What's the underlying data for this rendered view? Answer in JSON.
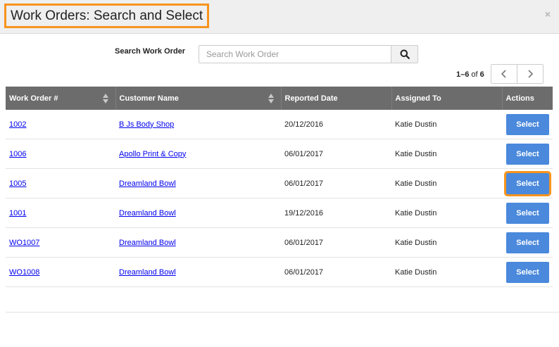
{
  "dialog": {
    "title": "Work Orders: Search and Select",
    "close_glyph": "×"
  },
  "search": {
    "label": "Search Work Order",
    "placeholder": "Search Work Order",
    "value": ""
  },
  "pager": {
    "range": "1–6",
    "of": "of",
    "total": "6"
  },
  "colors": {
    "header_bg": "#6c6c6c",
    "select_button": "#4a89dc",
    "highlight": "#f7941d"
  },
  "table": {
    "columns": [
      "Work Order #",
      "Customer Name",
      "Reported Date",
      "Assigned To",
      "Actions"
    ],
    "rows": [
      {
        "wo": "1002",
        "customer": "B Js Body Shop",
        "date": "20/12/2016",
        "assigned": "Katie Dustin",
        "action": "Select"
      },
      {
        "wo": "1006",
        "customer": "Apollo Print & Copy",
        "date": "06/01/2017",
        "assigned": "Katie Dustin",
        "action": "Select"
      },
      {
        "wo": "1005",
        "customer": "Dreamland Bowl",
        "date": "06/01/2017",
        "assigned": "Katie Dustin",
        "action": "Select"
      },
      {
        "wo": "1001",
        "customer": "Dreamland Bowl",
        "date": "19/12/2016",
        "assigned": "Katie Dustin",
        "action": "Select"
      },
      {
        "wo": "WO1007",
        "customer": "Dreamland Bowl",
        "date": "06/01/2017",
        "assigned": "Katie Dustin",
        "action": "Select"
      },
      {
        "wo": "WO1008",
        "customer": "Dreamland Bowl",
        "date": "06/01/2017",
        "assigned": "Katie Dustin",
        "action": "Select"
      }
    ]
  }
}
